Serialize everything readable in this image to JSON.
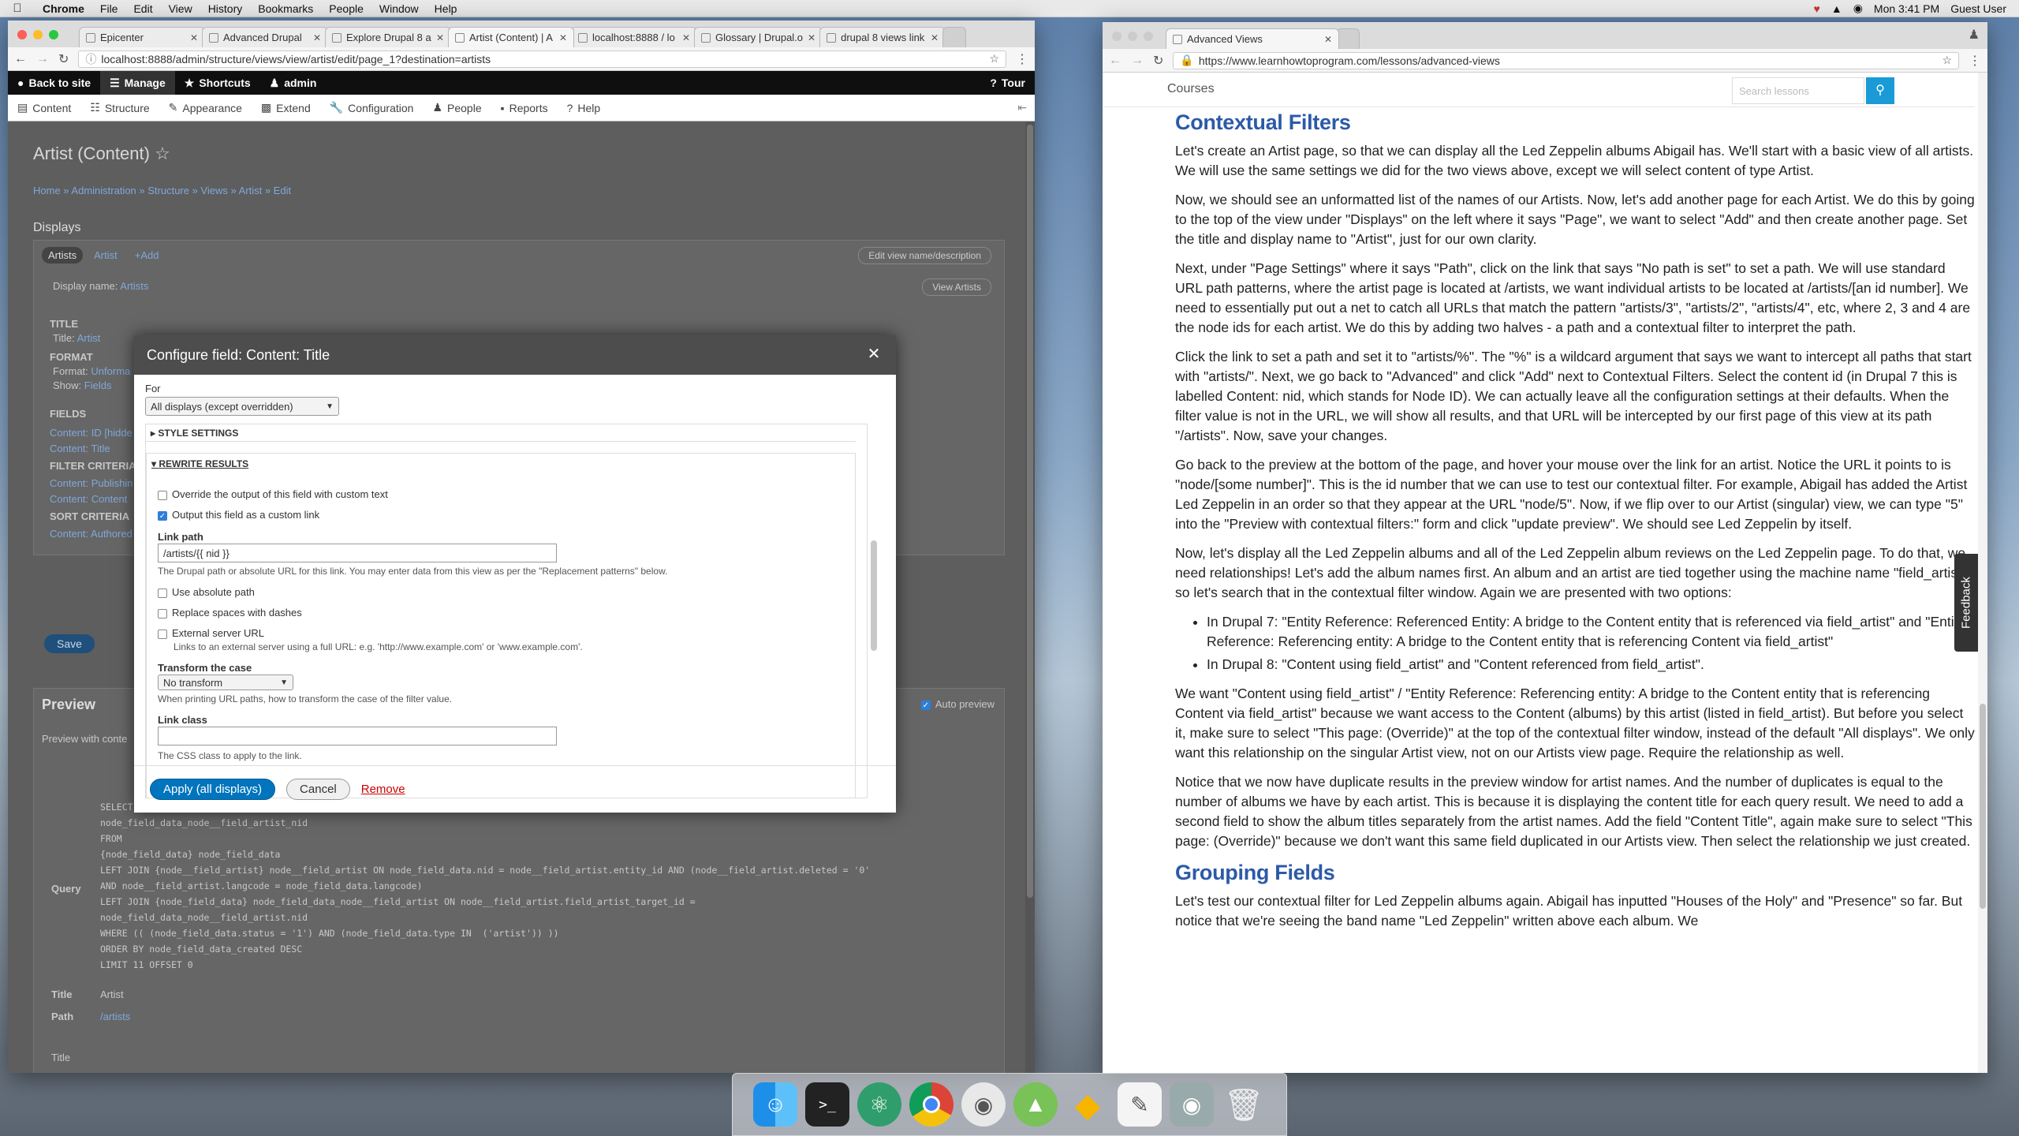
{
  "menubar": {
    "app": "Chrome",
    "items": [
      "File",
      "Edit",
      "View",
      "History",
      "Bookmarks",
      "People",
      "Window",
      "Help"
    ],
    "clock": "Mon 3:41 PM",
    "user": "Guest User"
  },
  "left_browser": {
    "tabs": [
      "Epicenter",
      "Advanced Drupal",
      "Explore Drupal 8 a",
      "Artist (Content) | A",
      "localhost:8888 / lo",
      "Glossary | Drupal.o",
      "drupal 8 views link"
    ],
    "url": "localhost:8888/admin/structure/views/view/artist/edit/page_1?destination=artists",
    "toolbar": {
      "back": "Back to site",
      "manage": "Manage",
      "shortcuts": "Shortcuts",
      "user": "admin",
      "tour": "Tour"
    },
    "tray": [
      "Content",
      "Structure",
      "Appearance",
      "Extend",
      "Configuration",
      "People",
      "Reports",
      "Help"
    ],
    "page": {
      "title": "Artist (Content)",
      "breadcrumb": "Home » Administration » Structure » Views » Artist » Edit",
      "displays_label": "Displays",
      "display_tabs": [
        "Artists",
        "Artist",
        "+Add"
      ],
      "edit_view_name": "Edit view name/description",
      "display_name_label": "Display name:",
      "display_name_value": "Artists",
      "view_artists_btn": "View Artists",
      "sections": {
        "title_h": "TITLE",
        "title_v": "Title:",
        "title_link": "Artist",
        "format_h": "FORMAT",
        "format_v": "Format:",
        "format_link": "Unforma",
        "show_v": "Show:",
        "show_link": "Fields",
        "fields_h": "FIELDS",
        "field1": "Content: ID [hidde",
        "field2": "Content: Title",
        "filter_h": "FILTER CRITERIA",
        "filter1": "Content: Publishin",
        "filter2": "Content: Content",
        "sort_h": "SORT CRITERIA",
        "sort1": "Content: Authored"
      },
      "save": "Save",
      "preview_h": "Preview",
      "auto_preview": "Auto preview",
      "preview_with": "Preview with conte",
      "query_label": "Query",
      "query_lines": [
        "SELECT node_field_data.created AS node_field_data_created, node_field_data.nid AS nid, node_field_data_node__field_artist.nid AS",
        "node_field_data_node__field_artist_nid",
        "FROM",
        "{node_field_data} node_field_data",
        "LEFT JOIN {node__field_artist} node__field_artist ON node_field_data.nid = node__field_artist.entity_id AND (node__field_artist.deleted = '0'",
        "AND node__field_artist.langcode = node_field_data.langcode)",
        "LEFT JOIN {node_field_data} node_field_data_node__field_artist ON node__field_artist.field_artist_target_id =",
        "node_field_data_node__field_artist.nid",
        "WHERE (( (node_field_data.status = '1') AND (node_field_data.type IN  ('artist')) ))",
        "ORDER BY node_field_data_created DESC",
        "LIMIT 11 OFFSET 0"
      ],
      "title_label": "Title",
      "title_value": "Artist",
      "path_label": "Path",
      "path_value": "/artists",
      "bottom_title": "Title"
    },
    "modal": {
      "title": "Configure field: Content: Title",
      "for_label": "For",
      "for_value": "All displays (except overridden)",
      "style_settings": "STYLE SETTINGS",
      "rewrite_results": "REWRITE RESULTS",
      "override_label": "Override the output of this field with custom text",
      "custom_link_label": "Output this field as a custom link",
      "link_path_label": "Link path",
      "link_path_value": "/artists/{{ nid }}",
      "link_path_desc": "The Drupal path or absolute URL for this link. You may enter data from this view as per the \"Replacement patterns\" below.",
      "absolute_label": "Use absolute path",
      "dashes_label": "Replace spaces with dashes",
      "external_label": "External server URL",
      "external_desc": "Links to an external server using a full URL: e.g. 'http://www.example.com' or 'www.example.com'.",
      "transform_label": "Transform the case",
      "transform_value": "No transform",
      "transform_desc": "When printing URL paths, how to transform the case of the filter value.",
      "link_class_label": "Link class",
      "link_class_desc": "The CSS class to apply to the link.",
      "apply": "Apply (all displays)",
      "cancel": "Cancel",
      "remove": "Remove"
    }
  },
  "right_browser": {
    "tab": "Advanced Views",
    "url": "https://www.learnhowtoprogram.com/lessons/advanced-views",
    "courses": "Courses",
    "search_placeholder": "Search lessons",
    "feedback": "Feedback",
    "h_contextual": "Contextual Filters",
    "p1": "Let's create an Artist page, so that we can display all the Led Zeppelin albums Abigail has. We'll start with a basic view of all artists. We will use the same settings we did for the two views above, except we will select content of type Artist.",
    "p2": "Now, we should see an unformatted list of the names of our Artists. Now, let's add another page for each Artist. We do this by going to the top of the view under \"Displays\" on the left where it says \"Page\", we want to select \"Add\" and then create another page. Set the title and display name to \"Artist\", just for our own clarity.",
    "p3": "Next, under \"Page Settings\" where it says \"Path\", click on the link that says \"No path is set\" to set a path. We will use standard URL path patterns, where the artist page is located at /artists, we want individual artists to be located at /artists/[an id number]. We need to essentially put out a net to catch all URLs that match the pattern \"artists/3\", \"artists/2\", \"artists/4\", etc, where 2, 3 and 4 are the node ids for each artist. We do this by adding two halves - a path and a contextual filter to interpret the path.",
    "p4": "Click the link to set a path and set it to \"artists/%\". The \"%\" is a wildcard argument that says we want to intercept all paths that start with \"artists/\". Next, we go back to \"Advanced\" and click \"Add\" next to Contextual Filters. Select the content id (in Drupal 7 this is labelled Content: nid, which stands for Node ID). We can actually leave all the configuration settings at their defaults. When the filter value is not in the URL, we will show all results, and that URL will be intercepted by our first page of this view at its path \"/artists\". Now, save your changes.",
    "p5": "Go back to the preview at the bottom of the page, and hover your mouse over the link for an artist. Notice the URL it points to is \"node/[some number]\". This is the id number that we can use to test our contextual filter. For example, Abigail has added the Artist Led Zeppelin in an order so that they appear at the URL \"node/5\". Now, if we flip over to our Artist (singular) view, we can type \"5\" into the \"Preview with contextual filters:\" form and click \"update preview\". We should see Led Zeppelin by itself.",
    "p6": "Now, let's display all the Led Zeppelin albums and all of the Led Zeppelin album reviews on the Led Zeppelin page. To do that, we need relationships! Let's add the album names first. An album and an artist are tied together using the machine name \"field_artist\", so let's search that in the contextual filter window. Again we are presented with two options:",
    "li1": "In Drupal 7: \"Entity Reference: Referenced Entity: A bridge to the Content entity that is referenced via field_artist\" and \"Entity Reference: Referencing entity: A bridge to the Content entity that is referencing Content via field_artist\"",
    "li2": "In Drupal 8: \"Content using field_artist\" and \"Content referenced from field_artist\".",
    "p7": "We want \"Content using field_artist\" / \"Entity Reference: Referencing entity: A bridge to the Content entity that is referencing Content via field_artist\" because we want access to the Content (albums) by this artist (listed in field_artist). But before you select it, make sure to select \"This page: (Override)\" at the top of the contextual filter window, instead of the default \"All displays\". We only want this relationship on the singular Artist view, not on our Artists view page. Require the relationship as well.",
    "p8": "Notice that we now have duplicate results in the preview window for artist names. And the number of duplicates is equal to the number of albums we have by each artist. This is because it is displaying the content title for each query result. We need to add a second field to show the album titles separately from the artist names. Add the field \"Content Title\", again make sure to select \"This page: (Override)\" because we don't want this same field duplicated in our Artists view. Then select the relationship we just created.",
    "h_grouping": "Grouping Fields",
    "p9": "Let's test our contextual filter for Led Zeppelin albums again. Abigail has inputted \"Houses of the Holy\" and \"Presence\" so far. But notice that we're seeing the band name \"Led Zeppelin\" written above each album. We"
  },
  "dock_icons": [
    "finder-icon",
    "terminal-icon",
    "atom-icon",
    "chrome-icon",
    "sequel-pro-icon",
    "android-studio-icon",
    "sketch-icon",
    "textedit-icon",
    "disk-utility-icon",
    "trash-icon"
  ]
}
